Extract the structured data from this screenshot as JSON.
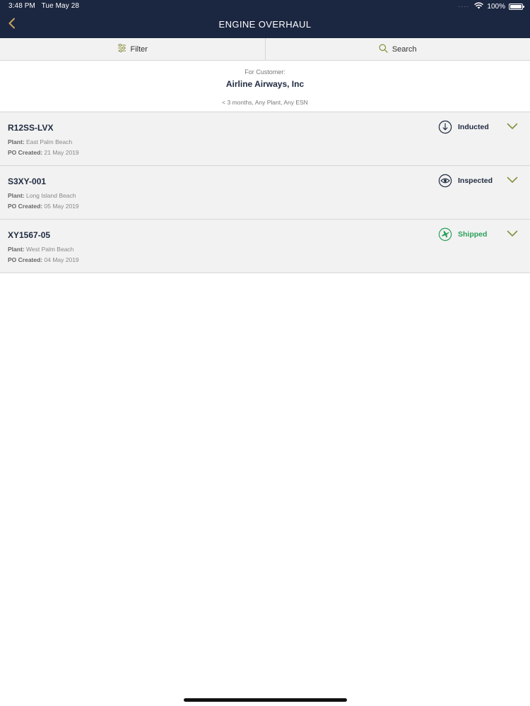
{
  "status_bar": {
    "time": "3:48 PM",
    "date": "Tue May 28",
    "battery": "100%",
    "battery_level_percent": 100
  },
  "nav": {
    "title": "ENGINE OVERHAUL",
    "back_icon": "chevron-left-icon"
  },
  "toolbar": {
    "filter_label": "Filter",
    "filter_icon": "sliders-icon",
    "search_label": "Search",
    "search_icon": "search-icon"
  },
  "customer": {
    "caption": "For Customer:",
    "name": "Airline Airways, Inc",
    "filters": "< 3 months, Any Plant, Any ESN"
  },
  "labels": {
    "plant": "Plant:",
    "po_created": "PO Created:"
  },
  "orders": [
    {
      "id": "R12SS-LVX",
      "plant": "East Palm Beach",
      "po_created": "21 May 2019",
      "status": "Inducted",
      "status_icon": "download-circle-icon",
      "status_color": "#1f2a40"
    },
    {
      "id": "S3XY-001",
      "plant": "Long Island Beach",
      "po_created": "05 May 2019",
      "status": "Inspected",
      "status_icon": "eye-icon",
      "status_color": "#1f2a40"
    },
    {
      "id": "XY1567-05",
      "plant": "West Palm Beach",
      "po_created": "04 May 2019",
      "status": "Shipped",
      "status_icon": "plane-icon",
      "status_color": "#2aa05a"
    }
  ],
  "colors": {
    "header_bg": "#1b2640",
    "accent_gold": "#c7a55c",
    "chevron_olive": "#8a8f3c",
    "shipped_green": "#2aa05a",
    "row_bg": "#f2f2f2"
  }
}
